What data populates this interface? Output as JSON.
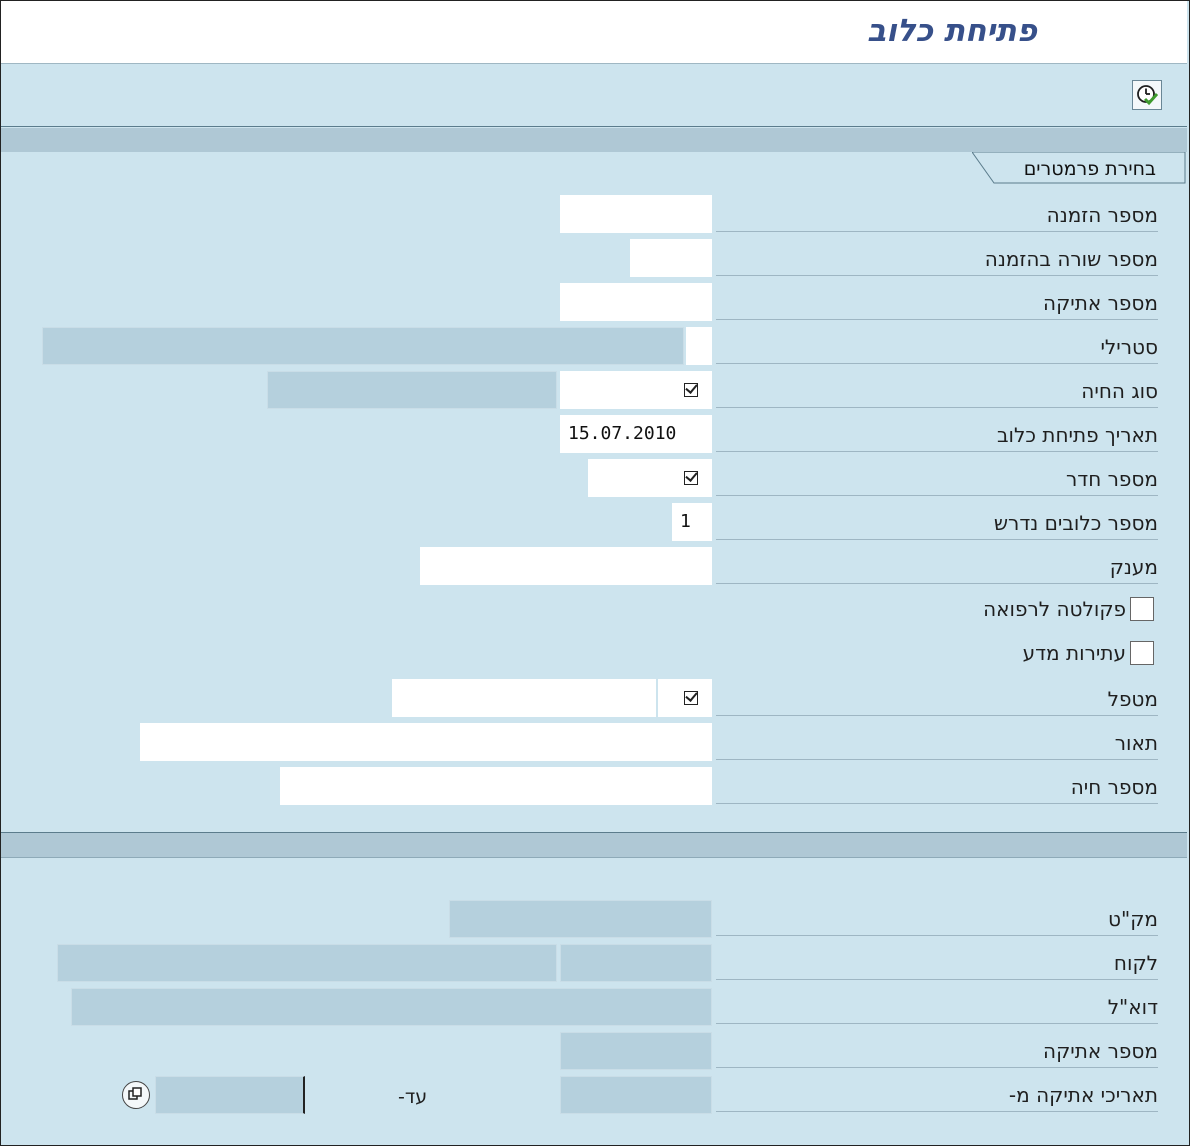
{
  "window": {
    "title": "פתיחת כלוב"
  },
  "toolbar": {
    "execute_icon": "clock-check-icon"
  },
  "section": {
    "tab_label": "בחירת פרמטרים"
  },
  "form": {
    "order_number": {
      "label": "מספר הזמנה",
      "value": ""
    },
    "order_line": {
      "label": "מספר שורה בהזמנה",
      "value": ""
    },
    "label_number": {
      "label": "מספר אתיקה",
      "value": ""
    },
    "sterile": {
      "label": "סטרילי",
      "value": ""
    },
    "animal_type": {
      "label": "סוג החיה",
      "value": ""
    },
    "cage_open_date": {
      "label": "תאריך פתיחת כלוב",
      "value": "15.07.2010"
    },
    "room_number": {
      "label": "מספר חדר",
      "value": ""
    },
    "cages_required": {
      "label": "מספר כלובים נדרש",
      "value": "1"
    },
    "grant": {
      "label": "מענק",
      "value": ""
    },
    "medicine_faculty": {
      "label": "פקולטה לרפואה",
      "checked": false
    },
    "science_future": {
      "label": "עתירות מדע",
      "checked": false
    },
    "caretaker": {
      "label": "מטפל",
      "value": ""
    },
    "description": {
      "label": "תאור",
      "value": ""
    },
    "animal_number": {
      "label": "מספר חיה",
      "value": ""
    }
  },
  "info": {
    "catalog": {
      "label": "מק\"ט"
    },
    "customer": {
      "label": "לקוח"
    },
    "email": {
      "label": "דוא\"ל"
    },
    "label_number": {
      "label": "מספר אתיקה"
    },
    "label_dates": {
      "label": "תאריכי אתיקה מ-",
      "to_label": "עד-"
    }
  }
}
